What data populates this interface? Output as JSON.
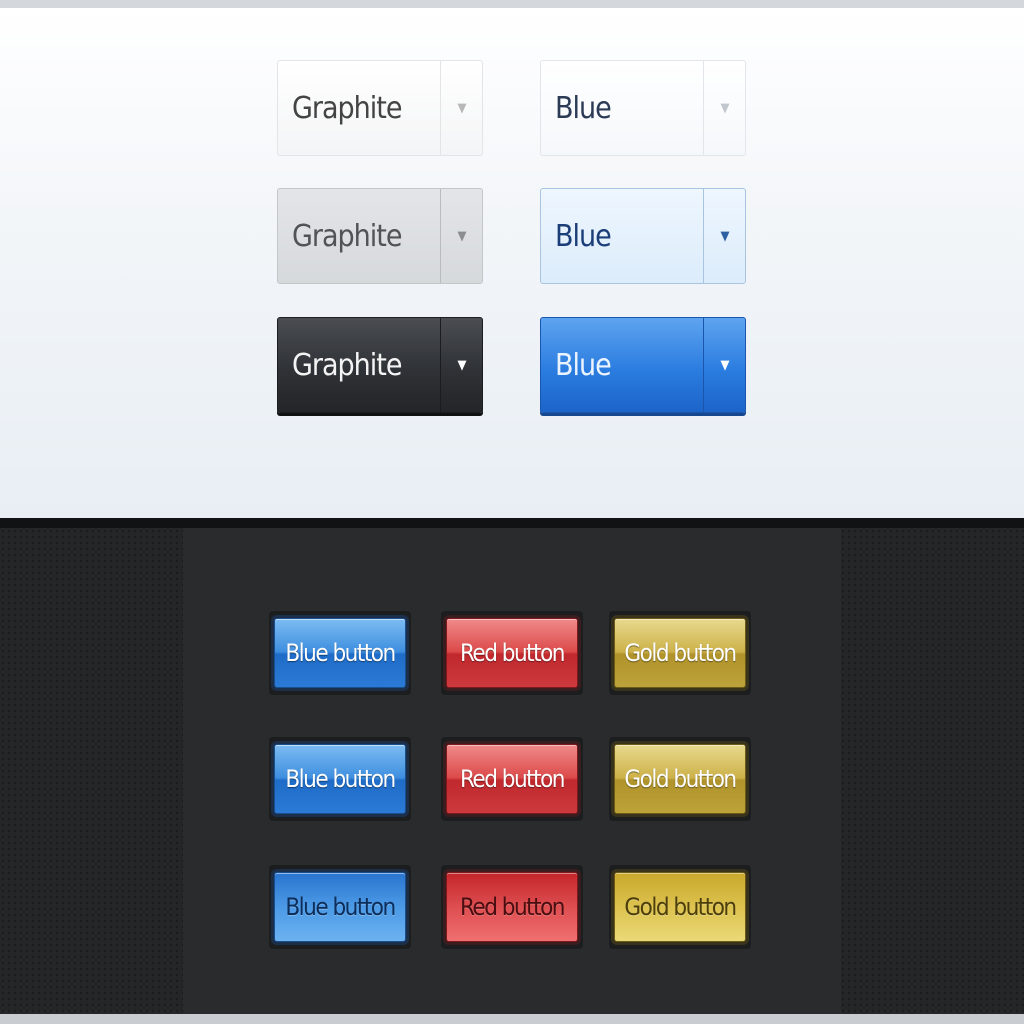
{
  "dropdowns": {
    "graphite": {
      "normal": {
        "label": "Graphite",
        "arrow": "▼"
      },
      "hover": {
        "label": "Graphite",
        "arrow": "▼"
      },
      "active": {
        "label": "Graphite",
        "arrow": "▼"
      }
    },
    "blue": {
      "normal": {
        "label": "Blue",
        "arrow": "▼"
      },
      "hover": {
        "label": "Blue",
        "arrow": "▼"
      },
      "active": {
        "label": "Blue",
        "arrow": "▼"
      }
    }
  },
  "buttons": {
    "blue": {
      "label_normal": "Blue button",
      "label_hover": "Blue button",
      "label_pressed": "Blue button"
    },
    "red": {
      "label_normal": "Red button",
      "label_hover": "Red button",
      "label_pressed": "Red button"
    },
    "gold": {
      "label_normal": "Gold button",
      "label_hover": "Gold button",
      "label_pressed": "Gold button"
    }
  },
  "colors": {
    "graphite_active": "#2f3236",
    "blue_active": "#2b7de0",
    "blue_button": "#3f8fe0",
    "red_button": "#dc4a4a",
    "gold_button": "#cdb24a",
    "dark_background": "#252628",
    "light_background": "#f3f6f9"
  },
  "icons": {
    "dropdown_arrow": "chevron-down-icon"
  }
}
